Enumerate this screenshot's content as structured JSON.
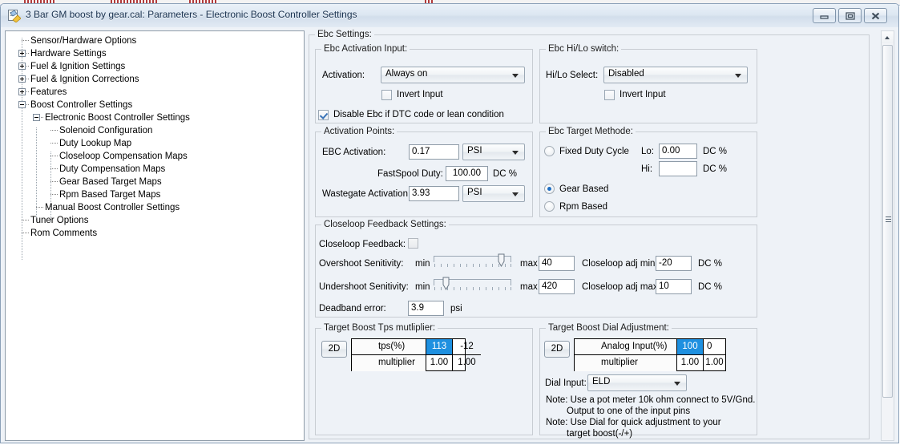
{
  "window": {
    "title": "3 Bar GM boost by gear.cal: Parameters - Electronic Boost Controller Settings",
    "icon": "document-properties-icon",
    "minimize_label": "Minimize",
    "restore_label": "Restore",
    "close_label": "Close"
  },
  "tree": {
    "items": [
      {
        "label": "Sensor/Hardware Options",
        "depth": 0,
        "toggle": "none"
      },
      {
        "label": "Hardware Settings",
        "depth": 0,
        "toggle": "plus"
      },
      {
        "label": "Fuel & Ignition Settings",
        "depth": 0,
        "toggle": "plus"
      },
      {
        "label": "Fuel & Ignition Corrections",
        "depth": 0,
        "toggle": "plus"
      },
      {
        "label": "Features",
        "depth": 0,
        "toggle": "plus"
      },
      {
        "label": "Boost Controller Settings",
        "depth": 0,
        "toggle": "minus"
      },
      {
        "label": "Electronic Boost Controller Settings",
        "depth": 1,
        "toggle": "minus"
      },
      {
        "label": "Solenoid Configuration",
        "depth": 2,
        "toggle": "none"
      },
      {
        "label": "Duty Lookup Map",
        "depth": 2,
        "toggle": "none"
      },
      {
        "label": "Closeloop Compensation Maps",
        "depth": 2,
        "toggle": "none"
      },
      {
        "label": "Duty Compensation Maps",
        "depth": 2,
        "toggle": "none"
      },
      {
        "label": "Gear Based Target Maps",
        "depth": 2,
        "toggle": "none"
      },
      {
        "label": "Rpm Based Target Maps",
        "depth": 2,
        "toggle": "none"
      },
      {
        "label": "Manual Boost Controller Settings",
        "depth": 1,
        "toggle": "none"
      },
      {
        "label": "Tuner Options",
        "depth": 0,
        "toggle": "none"
      },
      {
        "label": "Rom Comments",
        "depth": 0,
        "toggle": "none"
      }
    ]
  },
  "ebc_settings": {
    "title": "Ebc Settings:",
    "activation_input": {
      "title": "Ebc Activation Input:",
      "activation_label": "Activation:",
      "activation_value": "Always on",
      "invert_label": "Invert Input",
      "invert_checked": false,
      "disable_label": "Disable Ebc if DTC code or lean condition",
      "disable_checked": true
    },
    "hilo_switch": {
      "title": "Ebc Hi/Lo switch:",
      "select_label": "Hi/Lo Select:",
      "select_value": "Disabled",
      "invert_label": "Invert Input",
      "invert_checked": false
    },
    "activation_points": {
      "title": "Activation Points:",
      "ebc_activation_label": "EBC Activation:",
      "ebc_activation_value": "0.17",
      "ebc_activation_unit": "PSI",
      "fastspool_label": "FastSpool Duty:",
      "fastspool_value": "100.00",
      "fastspool_unit": "DC %",
      "wastegate_label": "Wastegate Activation:",
      "wastegate_value": "3.93",
      "wastegate_unit": "PSI"
    },
    "target_methode": {
      "title": "Ebc Target Methode:",
      "options": [
        {
          "label": "Fixed Duty Cycle",
          "selected": false
        },
        {
          "label": "Gear Based",
          "selected": true
        },
        {
          "label": "Rpm Based",
          "selected": false
        }
      ],
      "lo_label": "Lo:",
      "lo_value": "0.00",
      "lo_unit": "DC %",
      "hi_label": "Hi:",
      "hi_value": "",
      "hi_unit": "DC %"
    },
    "closeloop": {
      "title": "Closeloop Feedback Settings:",
      "feedback_label": "Closeloop Feedback:",
      "feedback_checked": false,
      "overshoot_label": "Overshoot Senitivity:",
      "overshoot_min": "min",
      "overshoot_max": "max",
      "overshoot_value": "40",
      "overshoot_slider_pct": 88,
      "undershoot_label": "Undershoot Senitivity:",
      "undershoot_min": "min",
      "undershoot_max": "max",
      "undershoot_value": "420",
      "undershoot_slider_pct": 12,
      "adj_min_label": "Closeloop adj min:",
      "adj_min_value": "-20",
      "adj_min_unit": "DC %",
      "adj_max_label": "Closeloop adj max:",
      "adj_max_value": "10",
      "adj_max_unit": "DC %",
      "deadband_label": "Deadband error:",
      "deadband_value": "3.9",
      "deadband_unit": "psi"
    },
    "tps_multiplier": {
      "title": "Target Boost Tps mutliplier:",
      "button_2d": "2D",
      "row1_label": "tps(%)",
      "row2_label": "multiplier",
      "row1_values": [
        "113",
        "-12"
      ],
      "row2_values": [
        "1.00",
        "1.00"
      ],
      "selected_cell": "113",
      "selection_color": "#1e90e0"
    },
    "dial_adjustment": {
      "title": "Target Boost Dial Adjustment:",
      "button_2d": "2D",
      "row1_label": "Analog Input(%)",
      "row2_label": "multiplier",
      "row1_values": [
        "100",
        "0"
      ],
      "row2_values": [
        "1.00",
        "1.00"
      ],
      "selected_cell": "100",
      "selection_color": "#1e90e0",
      "dial_input_label": "Dial Input:",
      "dial_input_value": "ELD",
      "notes": [
        "Note: Use a pot meter 10k ohm connect to 5V/Gnd.",
        "Output to one of the input pins",
        "Note: Use Dial for quick adjustment to your",
        "target boost(-/+)"
      ]
    }
  },
  "scrollbar": {
    "up_arrow": "scroll-up-arrow",
    "thumb": "scroll-thumb"
  }
}
